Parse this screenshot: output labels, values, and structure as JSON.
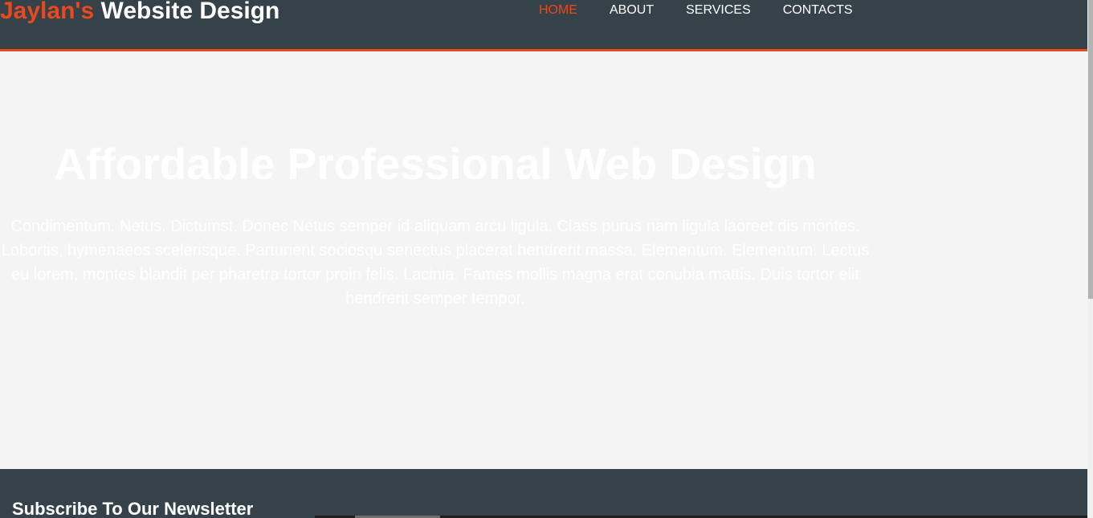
{
  "header": {
    "brand_highlight": "Jaylan's",
    "brand_rest": " Website Design",
    "nav": {
      "home": "HOME",
      "about": "ABOUT",
      "services": "SERVICES",
      "contacts": "CONTACTS"
    }
  },
  "showcase": {
    "title": "Affordable Professional Web Design",
    "body": "Condimentum. Netus. Dictumst. Donec Netus semper id aliquam arcu ligula. Class purus nam ligula laoreet dis montes. Lobortis, hymenaeos scelerisque. Parturient sociosqu senectus placerat hendrerit massa. Elementum. Elementum. Lectus eu lorem, montes blandit per pharetra tortor proin felis. Lacinia. Fames mollis magna erat conubia mattis. Duis tortor elit hendrerit semper tempor."
  },
  "newsletter": {
    "title": "Subscribe To Our Newsletter"
  },
  "colors": {
    "header_bg": "#35424a",
    "accent": "#e8491d",
    "page_bg": "#f4f4f4",
    "text_light": "#ffffff"
  }
}
